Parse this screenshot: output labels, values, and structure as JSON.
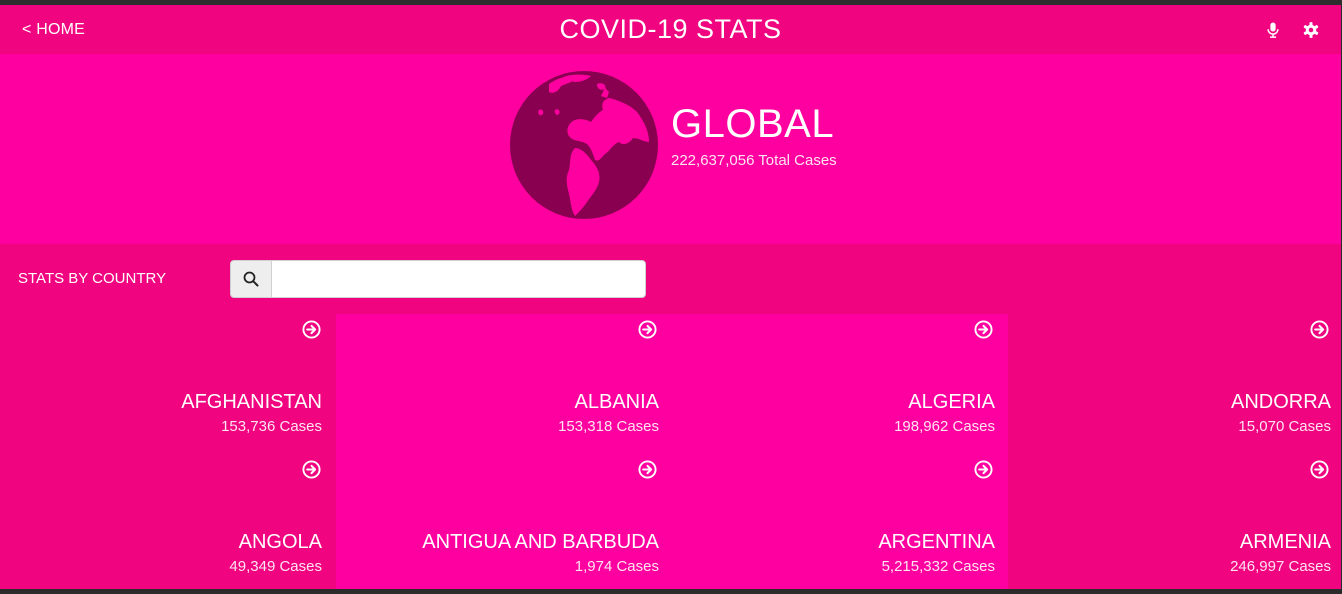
{
  "header": {
    "home_label": "< HOME",
    "title": "COVID-19 STATS",
    "mic_icon": "microphone-icon",
    "settings_icon": "gear-icon"
  },
  "global": {
    "title": "GLOBAL",
    "total_cases": "222,637,056 Total Cases",
    "icon": "globe-americas-icon"
  },
  "stats": {
    "label": "STATS BY COUNTRY",
    "search_icon": "search-icon",
    "search_value": "",
    "search_placeholder": ""
  },
  "countries": [
    {
      "name": "AFGHANISTAN",
      "cases": "153,736 Cases"
    },
    {
      "name": "ALBANIA",
      "cases": "153,318 Cases"
    },
    {
      "name": "ALGERIA",
      "cases": "198,962 Cases"
    },
    {
      "name": "ANDORRA",
      "cases": "15,070 Cases"
    },
    {
      "name": "ANGOLA",
      "cases": "49,349 Cases"
    },
    {
      "name": "ANTIGUA AND BARBUDA",
      "cases": "1,974 Cases"
    },
    {
      "name": "ARGENTINA",
      "cases": "5,215,332 Cases"
    },
    {
      "name": "ARMENIA",
      "cases": "246,997 Cases"
    }
  ],
  "colors": {
    "header": "#f0047f",
    "hero": "#ff00a0",
    "card_dark": "#f0047f",
    "card_light": "#ff00a0",
    "globe": "#8a0050"
  }
}
